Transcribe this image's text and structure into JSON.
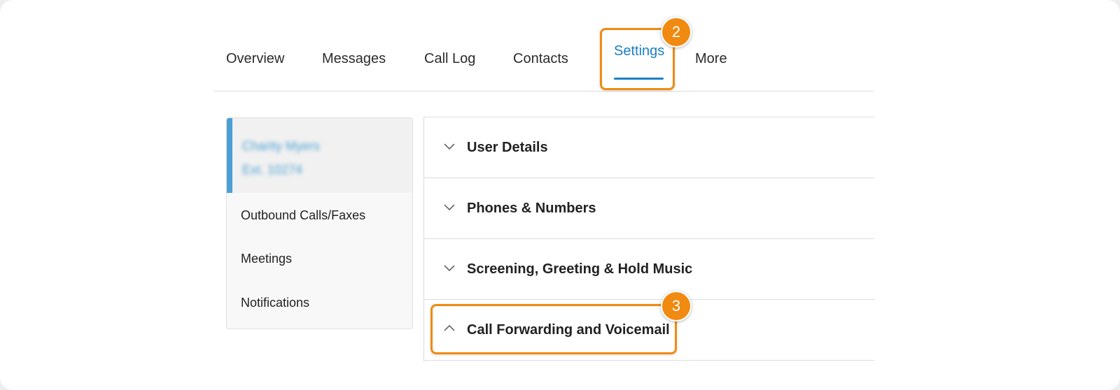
{
  "tabs": [
    {
      "label": "Overview"
    },
    {
      "label": "Messages"
    },
    {
      "label": "Call Log"
    },
    {
      "label": "Contacts"
    },
    {
      "label": "Settings",
      "active": true
    },
    {
      "label": "More"
    }
  ],
  "steps": {
    "tab_step": "2",
    "accordion_step": "3"
  },
  "sidebar": {
    "user": {
      "name": "Charity Myers",
      "extension": "Ext. 10274"
    },
    "items": [
      {
        "label": "Outbound Calls/Faxes"
      },
      {
        "label": "Meetings"
      },
      {
        "label": "Notifications"
      }
    ]
  },
  "sections": [
    {
      "label": "User Details",
      "icon": "chevron-down-icon"
    },
    {
      "label": "Phones & Numbers",
      "icon": "chevron-down-icon"
    },
    {
      "label": "Screening, Greeting & Hold Music",
      "icon": "chevron-down-icon"
    },
    {
      "label": "Call Forwarding and Voicemail",
      "icon": "chevron-up-icon"
    }
  ],
  "colors": {
    "accent": "#1a7fc4",
    "highlight": "#f08a10",
    "user_bar": "#4ba0d4"
  }
}
